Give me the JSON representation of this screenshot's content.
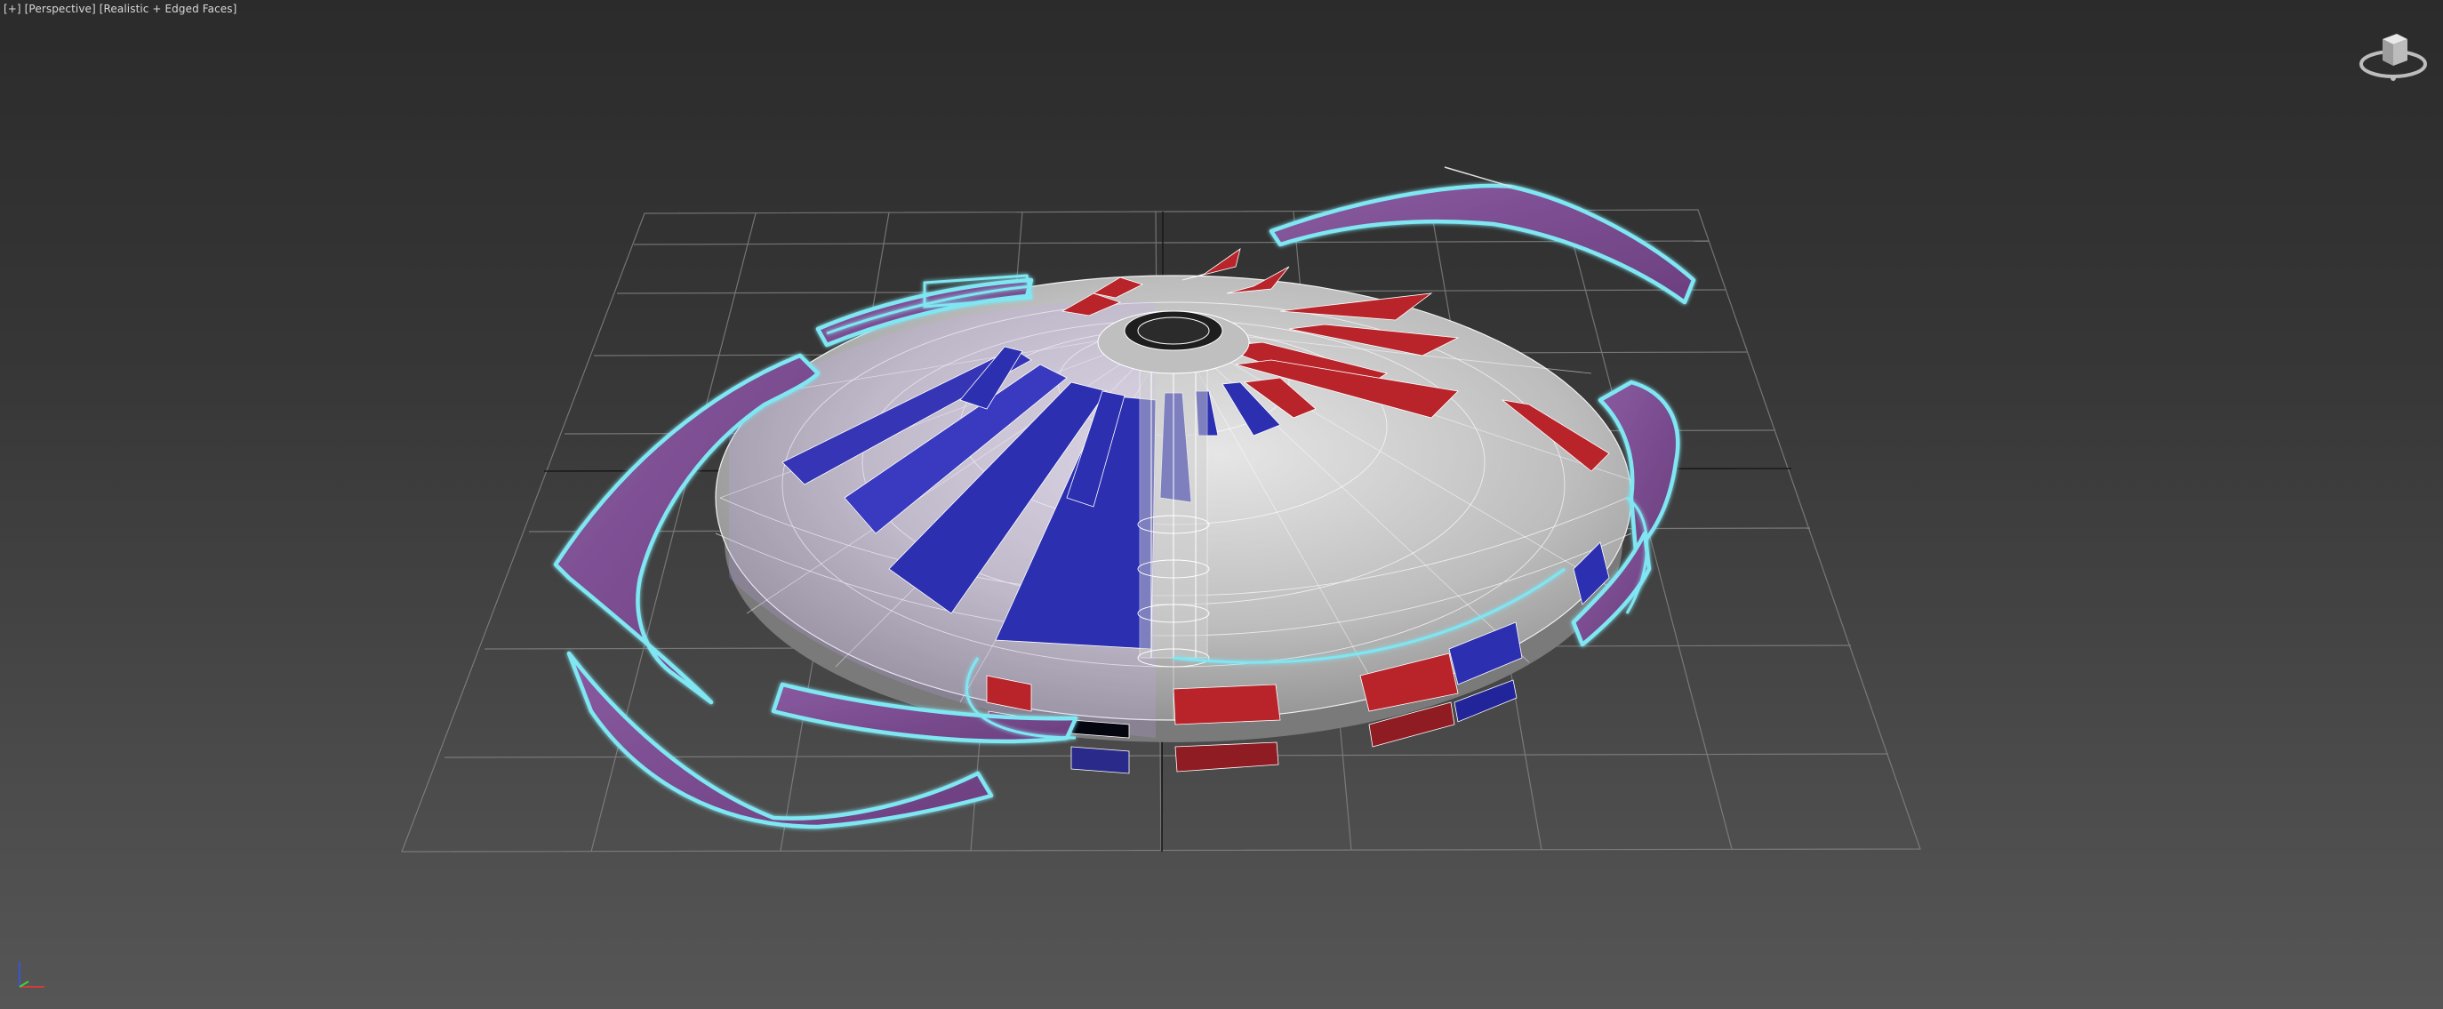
{
  "viewport": {
    "label_plus": "[+]",
    "label_view": "[Perspective]",
    "label_shading": "[Realistic + Edged Faces]"
  },
  "icons": {
    "viewcube": "viewcube-icon",
    "axis_tripod": "axis-tripod-icon"
  },
  "colors": {
    "background_top": "#2b2b2b",
    "background_bottom": "#565656",
    "grid": "#8a8a8a",
    "selection_outline": "#7fe6f2",
    "purple_blade": "#7d4f92",
    "red_panel": "#b8242a",
    "blue_panel": "#2c2fb0",
    "body_gray": "#c9c9c9"
  }
}
